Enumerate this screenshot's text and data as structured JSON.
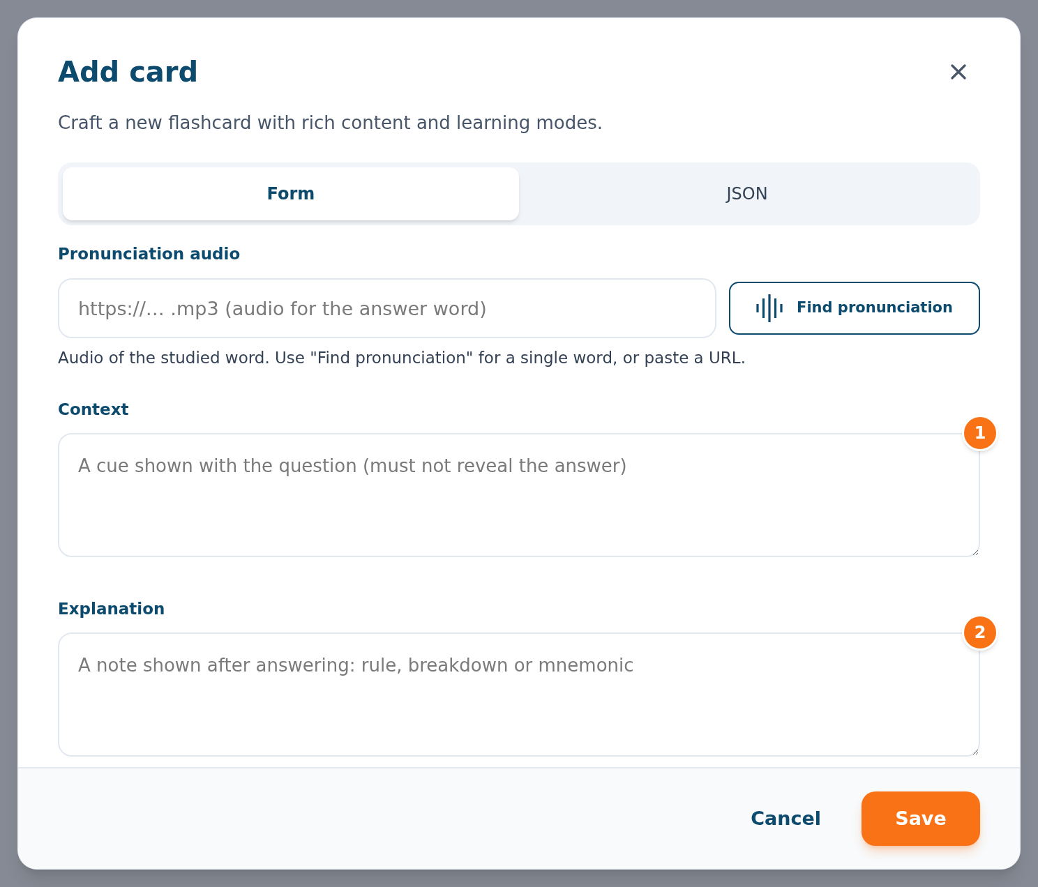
{
  "dialog": {
    "title": "Add card",
    "subtitle": "Craft a new flashcard with rich content and learning modes."
  },
  "tabs": [
    {
      "label": "Form",
      "selected": true
    },
    {
      "label": "JSON",
      "selected": false
    }
  ],
  "fields": [
    {
      "kind": "url",
      "label": "Pronunciation audio",
      "placeholder": "https://… .mp3 (audio for the answer word)",
      "button": "Find pronunciation",
      "help": "Audio of the studied word. Use \"Find pronunciation\" for a single word, or paste a URL."
    },
    {
      "kind": "textarea",
      "label": "Context",
      "placeholder": "A cue shown with the question (must not reveal the answer)",
      "badge": "1"
    },
    {
      "kind": "textarea",
      "label": "Explanation",
      "placeholder": "A note shown after answering: rule, breakdown or mnemonic",
      "badge": "2"
    }
  ],
  "footer": {
    "cancel": "Cancel",
    "save": "Save"
  }
}
